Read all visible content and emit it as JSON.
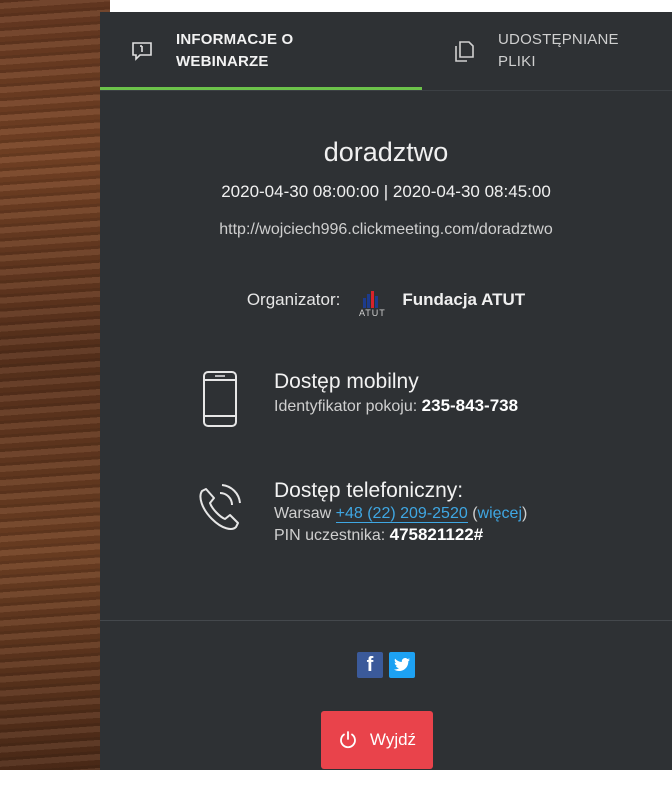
{
  "tabs": {
    "info_label": "INFORMACJE O WEBINARZE",
    "files_label": "UDOSTĘPNIANE PLIKI"
  },
  "webinar": {
    "title": "doradztwo",
    "dates": "2020-04-30 08:00:00 | 2020-04-30 08:45:00",
    "url": "http://wojciech996.clickmeeting.com/doradztwo",
    "organizer_label": "Organizator:",
    "organizer_logo_text": "ATUT",
    "organizer_name": "Fundacja ATUT"
  },
  "mobile": {
    "title": "Dostęp mobilny",
    "room_label": "Identyfikator pokoju:",
    "room_id": "235-843-738"
  },
  "phone": {
    "title": "Dostęp telefoniczny:",
    "city": "Warsaw",
    "number": "+48 (22) 209-2520",
    "more_open": "(",
    "more_label": "więcej",
    "more_close": ")",
    "pin_label": "PIN uczestnika:",
    "pin": "475821122#"
  },
  "social": {
    "facebook": "f",
    "twitter": "t"
  },
  "exit_label": "Wyjdź",
  "colors": {
    "panel": "#2e3134",
    "accent_green": "#6cc24a",
    "link": "#3fa7e3",
    "exit": "#e9434b"
  }
}
